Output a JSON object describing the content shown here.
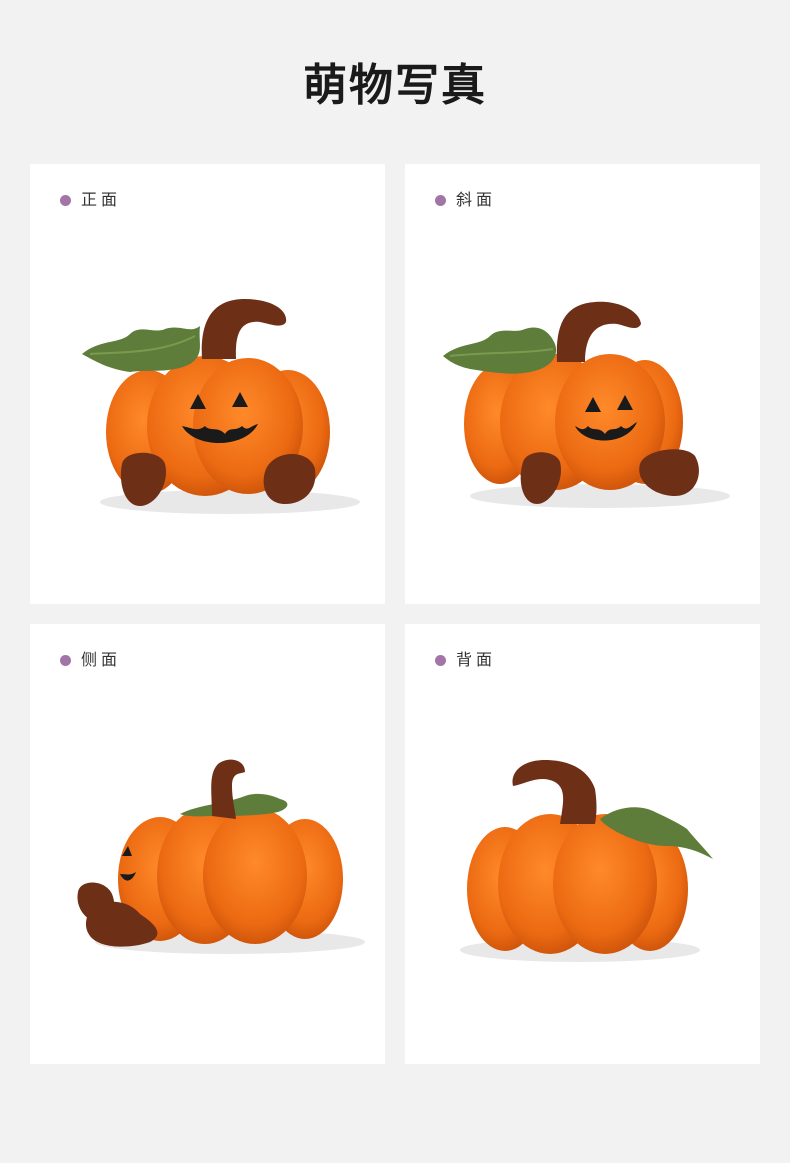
{
  "page": {
    "title": "萌物写真"
  },
  "colors": {
    "background": "#f2f2f2",
    "card": "#ffffff",
    "dot": "#a275a6",
    "pumpkin": "#ec6a12",
    "stem": "#6e2f17",
    "leaf": "#5e7d3a"
  },
  "views": [
    {
      "label": "正面",
      "image": "pumpkin-plush-front-photo"
    },
    {
      "label": "斜面",
      "image": "pumpkin-plush-angled-photo"
    },
    {
      "label": "侧面",
      "image": "pumpkin-plush-side-photo"
    },
    {
      "label": "背面",
      "image": "pumpkin-plush-back-photo"
    }
  ]
}
